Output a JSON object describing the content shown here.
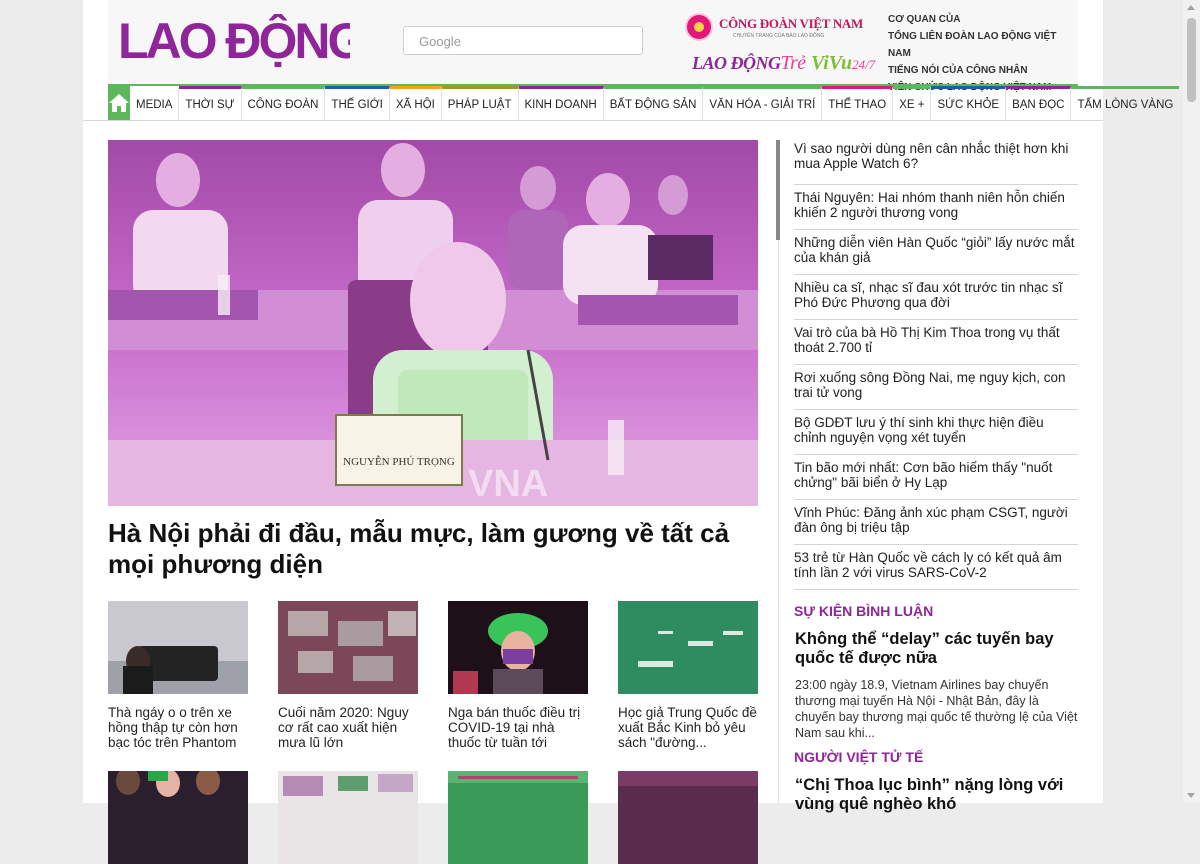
{
  "header": {
    "logo_text": "LAO ĐỘNG",
    "search_placeholder": "Google",
    "partner1_name": "CÔNG ĐOÀN VIỆT NAM",
    "partner1_tag": "CHUYÊN TRANG CỦA BÁO LAO ĐỘNG",
    "partner2_main": "LAO ĐỘNG",
    "partner2_suffix": "Trẻ",
    "partner3_main": "ViVu",
    "partner3_suffix": "24/7",
    "coquan": [
      "CƠ QUAN CỦA",
      "TỔNG LIÊN ĐOÀN LAO ĐỘNG VIỆT NAM",
      "TIẾNG NÓI CỦA CÔNG NHÂN",
      "VIÊN CHỨC LAO ĐỘNG VIỆT NAM"
    ]
  },
  "nav": {
    "items": [
      {
        "label": "MEDIA",
        "color": "#ffffff"
      },
      {
        "label": "THỜI SỰ",
        "color": "#8e2598"
      },
      {
        "label": "CÔNG ĐOÀN",
        "color": "#5db85c"
      },
      {
        "label": "THẾ GIỚI",
        "color": "#1f5fa8"
      },
      {
        "label": "XÃ HỘI",
        "color": "#ff9e1b"
      },
      {
        "label": "PHÁP LUẬT",
        "color": "#9c9c1c"
      },
      {
        "label": "KINH DOANH",
        "color": "#8e2598"
      },
      {
        "label": "BẤT ĐỘNG SẢN",
        "color": "#5db85c"
      },
      {
        "label": "VĂN HÓA - GIẢI TRÍ",
        "color": "#5db85c"
      },
      {
        "label": "THỂ THAO",
        "color": "#e2177a"
      },
      {
        "label": "XE +",
        "color": "#5db85c"
      },
      {
        "label": "SỨC KHỎE",
        "color": "#1f5fa8"
      },
      {
        "label": "BẠN ĐỌC",
        "color": "#8e2598"
      },
      {
        "label": "TẤM LÒNG VÀNG",
        "color": "#5db85c"
      }
    ]
  },
  "main": {
    "hero_title": "Hà Nội phải đi đầu, mẫu mực, làm gương về tất cả mọi phương diện",
    "hero_nameplate": "NGUYỄN PHÚ TRỌNG",
    "hero_watermark": "VNA",
    "cards": [
      {
        "title": "Thà ngáy o o trên xe hồng thập tự còn hơn bạc tóc trên Phantom"
      },
      {
        "title": "Cuối năm 2020: Nguy cơ rất cao xuất hiện mưa lũ lớn"
      },
      {
        "title": "Nga bán thuốc điều trị COVID-19 tại nhà thuốc từ tuần tới"
      },
      {
        "title": "Học giả Trung Quốc đề xuất Bắc Kinh bỏ yêu sách \"đường..."
      }
    ]
  },
  "sidebar": {
    "news": [
      "Vì sao người dùng nên cân nhắc thiệt hơn khi mua Apple Watch 6?",
      "Thái Nguyên: Hai nhóm thanh niên hỗn chiến khiến 2 người thương vong",
      "Những diễn viên Hàn Quốc “giỏi” lấy nước mắt của khán giả",
      "Nhiều ca sĩ, nhạc sĩ đau xót trước tin nhạc sĩ Phó Đức Phương qua đời",
      "Vai trò của bà Hồ Thị Kim Thoa trong vụ thất thoát 2.700 tỉ",
      "Rơi xuống sông Đồng Nai, mẹ nguy kịch, con trai tử vong",
      "Bộ GDĐT lưu ý thí sinh khi thực hiện điều chỉnh nguyện vọng xét tuyển",
      "Tin bão mới nhất: Cơn bão hiếm thấy \"nuốt chửng\" bãi biển ở Hy Lạp",
      "Vĩnh Phúc: Đăng ảnh xúc phạm CSGT, người đàn ông bị triệu tập",
      "53 trẻ từ Hàn Quốc về cách ly có kết quả âm tính lần 2 với virus SARS-CoV-2"
    ],
    "section1_title": "SỰ KIỆN BÌNH LUẬN",
    "section1_headline": "Không thể “delay” các tuyến bay quốc tế được nữa",
    "section1_desc": "23:00 ngày 18.9, Vietnam Airlines bay chuyến thương mại tuyến Hà Nội - Nhật Bản, đây là chuyến bay thương mại quốc tế thường lệ của Việt Nam sau khi...",
    "section2_title": "NGƯỜI VIỆT TỬ TẾ",
    "section2_headline": "“Chị Thoa lục bình” nặng lòng với vùng quê nghèo khó"
  }
}
